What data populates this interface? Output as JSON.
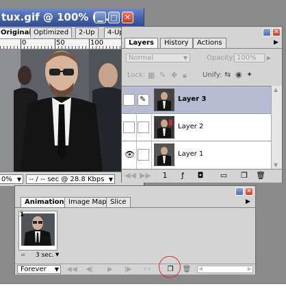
{
  "document_window": {
    "title": "tux.gif @ 100% (O...",
    "tabs": [
      "Original",
      "Optimized",
      "2-Up",
      "4-Up"
    ],
    "ruler_labels": [
      "0",
      "50",
      "100"
    ],
    "zoom": "0%",
    "download_info": "-- / -- sec @ 28.8 Kbps"
  },
  "layers_palette": {
    "tabs": [
      "Layers",
      "History",
      "Actions"
    ],
    "blend_mode": "Normal",
    "opacity_label": "Opacity:",
    "opacity_value": "100%",
    "lock_label": "Lock:",
    "unify_label": "Unify:",
    "layers": [
      {
        "name": "Layer 3",
        "selected": true,
        "visible": false
      },
      {
        "name": "Layer 2",
        "selected": false,
        "visible": false
      },
      {
        "name": "Layer 1",
        "selected": false,
        "visible": true
      }
    ],
    "frame_number": "1"
  },
  "animation_palette": {
    "tabs": [
      "Animation",
      "Image Map",
      "Slice"
    ],
    "frame_number": "1",
    "frame_delay": "3 sec.",
    "loop": "Forever"
  },
  "colors": {
    "title_bar": "#3f5ea8",
    "palette_bg": "#d4d4d4",
    "selected_layer": "#b8bcd2",
    "highlight_circle": "#d9312b"
  }
}
